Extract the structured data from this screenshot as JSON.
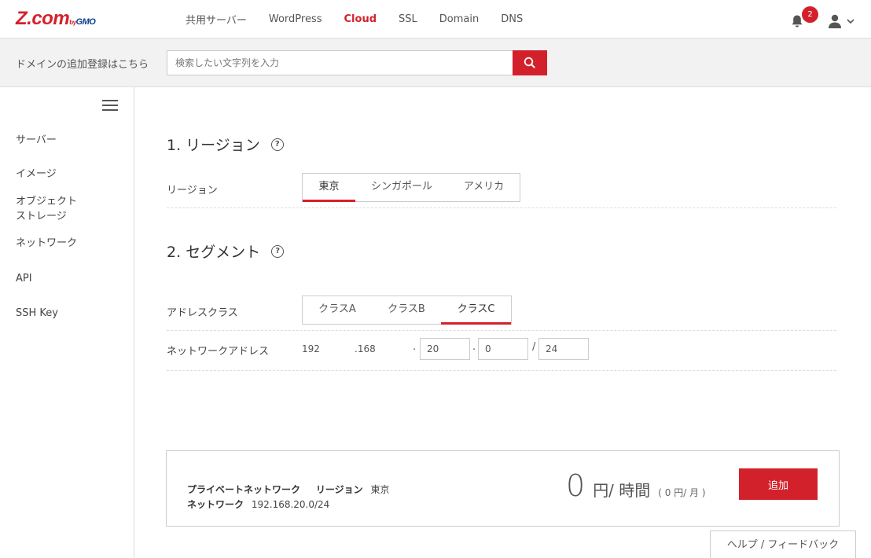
{
  "header": {
    "logo_main": "Z.com",
    "logo_by": "by",
    "logo_gmo": "GMO",
    "nav": [
      {
        "label": "共用サーバー",
        "active": false
      },
      {
        "label": "WordPress",
        "active": false
      },
      {
        "label": "Cloud",
        "active": true
      },
      {
        "label": "SSL",
        "active": false
      },
      {
        "label": "Domain",
        "active": false
      },
      {
        "label": "DNS",
        "active": false
      }
    ],
    "notification_count": "2",
    "icons": [
      "bell-icon",
      "user-icon",
      "chevron-down-icon"
    ]
  },
  "search": {
    "label": "ドメインの追加登録はこちら",
    "placeholder": "検索したい文字列を入力",
    "value": "",
    "button_icon": "search-icon"
  },
  "sidebar": {
    "items": [
      {
        "label": "サーバー"
      },
      {
        "label": "イメージ"
      },
      {
        "label": "オブジェクト\nストレージ"
      },
      {
        "label": "ネットワーク"
      },
      {
        "label": "API"
      },
      {
        "label": "SSH Key"
      }
    ]
  },
  "region": {
    "title": "1. リージョン",
    "help": "?",
    "label": "リージョン",
    "options": [
      "東京",
      "シンガポール",
      "アメリカ"
    ],
    "selected": "東京"
  },
  "segment": {
    "title": "2. セグメント",
    "help": "?",
    "class_label": "アドレスクラス",
    "class_options": [
      "クラスA",
      "クラスB",
      "クラスC"
    ],
    "selected_class": "クラスC",
    "network_label": "ネットワークアドレス",
    "octet1": "192",
    "octet2": ".168",
    "dot": ".",
    "octet3": "20",
    "octet4": "0",
    "slash": "/",
    "prefix": "24"
  },
  "summary": {
    "line1_label": "プライベートネットワーク",
    "line1_region_label": "リージョン",
    "line1_region_value": "東京",
    "line2_label": "ネットワーク",
    "line2_value": "192.168.20.0/24",
    "price": "0",
    "price_unit": "円/ 時間",
    "price_month": "( 0 円/ 月 )",
    "add_button": "追加"
  },
  "feedback": "ヘルプ / フィードバック",
  "colors": {
    "accent": "#d3212c",
    "border": "#cccccc",
    "band": "#f2f2f2"
  }
}
